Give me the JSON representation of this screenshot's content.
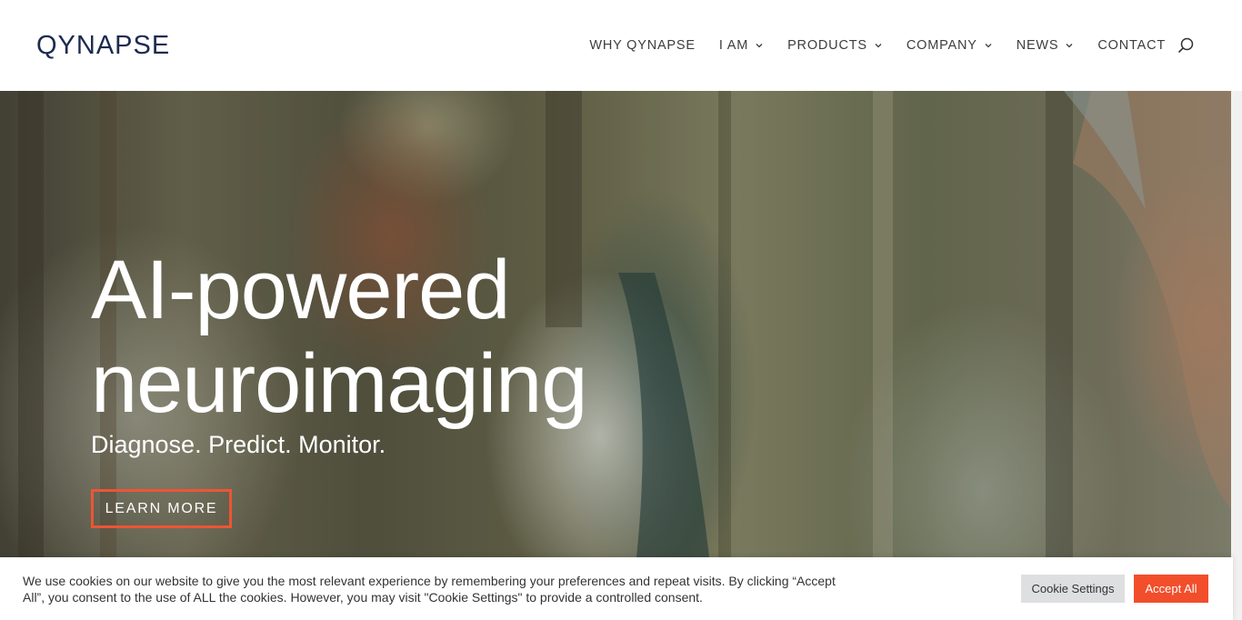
{
  "header": {
    "logo_text": "QYNAPSE",
    "brand_color": "#1d2b4f",
    "nav": [
      {
        "label": "WHY QYNAPSE",
        "has_dropdown": false
      },
      {
        "label": "I AM",
        "has_dropdown": true
      },
      {
        "label": "PRODUCTS",
        "has_dropdown": true
      },
      {
        "label": "COMPANY",
        "has_dropdown": true
      },
      {
        "label": "NEWS",
        "has_dropdown": true
      },
      {
        "label": "CONTACT",
        "has_dropdown": false
      }
    ],
    "search_icon": "search-icon"
  },
  "hero": {
    "title_line1": "AI-powered",
    "title_line2": "neuroimaging",
    "subtitle": "Diagnose. Predict. Monitor.",
    "cta_label": "LEARN MORE",
    "cta_border_color": "#ee5533"
  },
  "cookie_bar": {
    "text": "We use cookies on our website to give you the most relevant experience by remembering your preferences and repeat visits. By clicking “Accept All”, you consent to the use of ALL the cookies. However, you may visit \"Cookie Settings\" to provide a controlled consent.",
    "settings_label": "Cookie Settings",
    "accept_label": "Accept All",
    "accept_color": "#f24e2b"
  }
}
